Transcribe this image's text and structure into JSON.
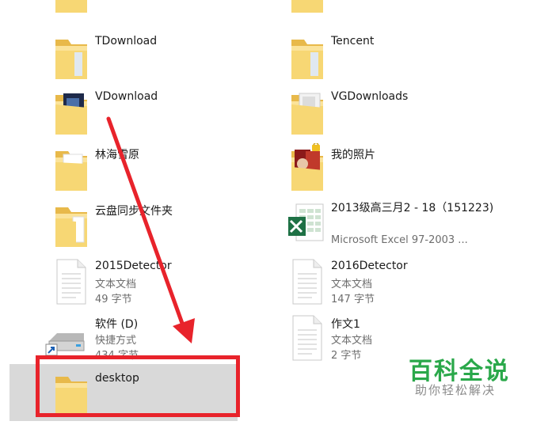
{
  "files": [
    {
      "name": "TDownload",
      "type": "folder"
    },
    {
      "name": "Tencent",
      "type": "folder"
    },
    {
      "name": "VDownload",
      "type": "folder-with-content"
    },
    {
      "name": "VGDownloads",
      "type": "folder-with-content"
    },
    {
      "name": "林海雪原",
      "type": "folder"
    },
    {
      "name": "我的照片",
      "type": "locked-photo-folder"
    },
    {
      "name": "云盘同步文件夹",
      "type": "folder"
    },
    {
      "name": "2013级高三月2 - 18（151223)",
      "type": "excel",
      "line2": "Microsoft Excel 97-2003 ..."
    },
    {
      "name": "2015Detector",
      "type": "text",
      "line2": "文本文档",
      "line3": "49 字节"
    },
    {
      "name": "2016Detector",
      "type": "text",
      "line2": "文本文档",
      "line3": "147 字节"
    },
    {
      "name": "软件 (D)",
      "type": "shortcut-drive",
      "line2": "快捷方式",
      "line3": "434 字节"
    },
    {
      "name": "作文1",
      "type": "text",
      "line2": "文本文档",
      "line3": "2 字节"
    },
    {
      "name": "desktop",
      "type": "folder",
      "selected": true
    }
  ],
  "watermark": {
    "title": "百科全说",
    "subtitle": "助你轻松解决"
  },
  "colors": {
    "annotation": "#e8232b",
    "folder": "#f7d774",
    "selection": "#d9d9d9",
    "watermark": "#2aa84a"
  }
}
